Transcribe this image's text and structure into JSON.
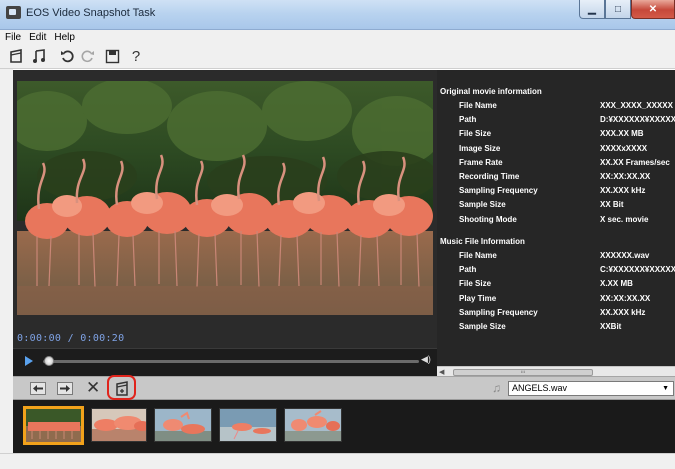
{
  "window": {
    "title": "EOS Video Snapshot Task"
  },
  "menu": [
    "File",
    "Edit",
    "Help"
  ],
  "toolbar": {
    "icons": [
      "save-snapshot-icon",
      "music-icon",
      "rotate-left-icon",
      "rotate-right-icon",
      "save-icon",
      "help-icon"
    ],
    "help_label": "?"
  },
  "player": {
    "time": "0:00:00 / 0:00:20",
    "progress": 0.0
  },
  "info": {
    "movie_section_title": "Original movie information",
    "movie_rows": [
      {
        "label": "File Name",
        "value": "XXX_XXXX_XXXXX"
      },
      {
        "label": "Path",
        "value": "D:¥XXXXXX¥XXXXX"
      },
      {
        "label": "File Size",
        "value": "XXX.XX MB"
      },
      {
        "label": "Image Size",
        "value": "XXXXxXXXX"
      },
      {
        "label": "Frame Rate",
        "value": "XX.XX Frames/sec"
      },
      {
        "label": "Recording Time",
        "value": "XX:XX:XX.XX"
      },
      {
        "label": "Sampling Frequency",
        "value": "XX.XXX kHz"
      },
      {
        "label": "Sample Size",
        "value": "XX Bit"
      },
      {
        "label": "Shooting Mode",
        "value": "X sec. movie"
      }
    ],
    "music_section_title": "Music File Information",
    "music_rows": [
      {
        "label": "File Name",
        "value": "XXXXXX.wav"
      },
      {
        "label": "Path",
        "value": "C:¥XXXXXX¥XXXXX"
      },
      {
        "label": "File Size",
        "value": "X.XX MB"
      },
      {
        "label": "Play Time",
        "value": "XX:XX:XX.XX"
      },
      {
        "label": "Sampling Frequency",
        "value": "XX.XXX kHz"
      },
      {
        "label": "Sample Size",
        "value": "XXBit"
      }
    ]
  },
  "controls": {
    "music_file": "ANGELS.wav",
    "delete_label": "✕"
  },
  "thumbnails": {
    "count": 5,
    "selected_index": 0
  }
}
